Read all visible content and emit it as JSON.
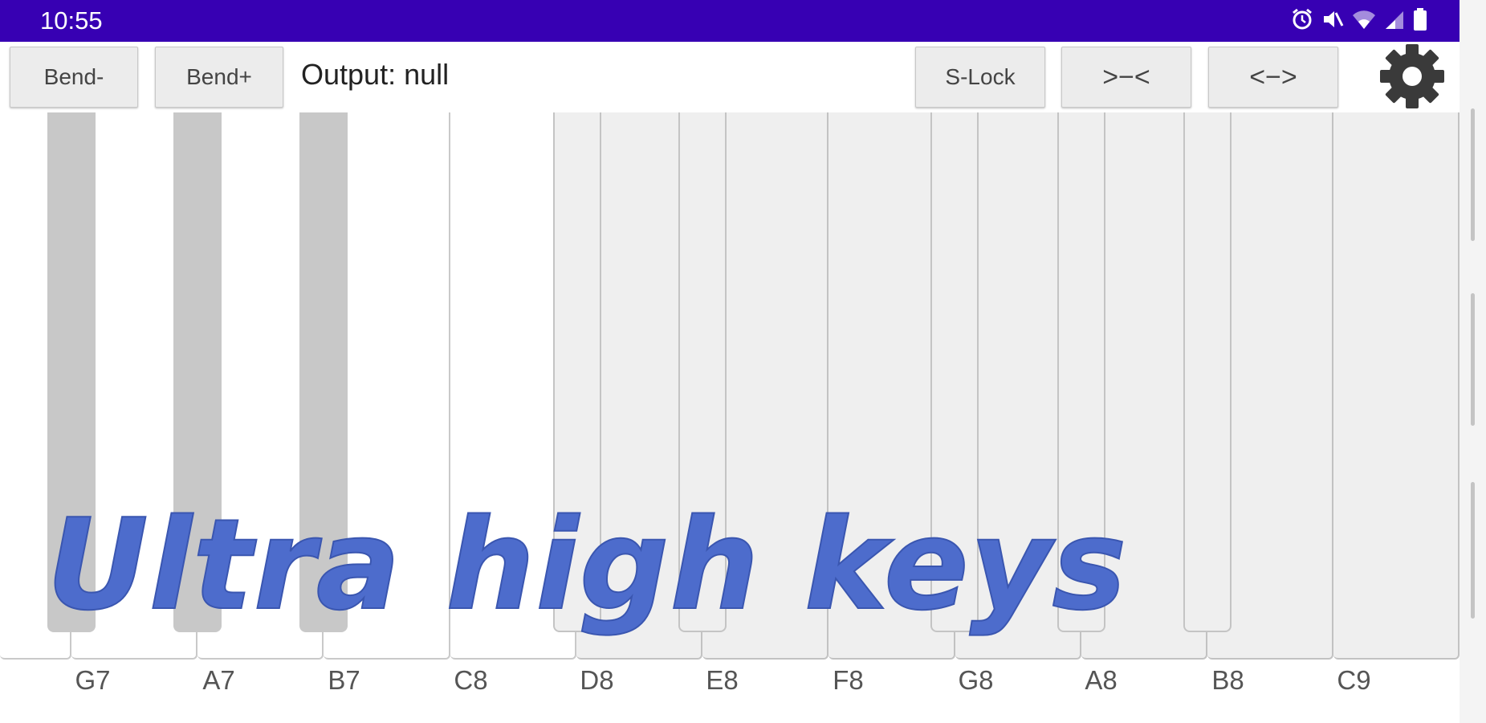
{
  "status_bar": {
    "time": "10:55",
    "icons": [
      "alarm-icon",
      "mute-icon",
      "wifi-icon",
      "signal-icon",
      "battery-icon"
    ]
  },
  "toolbar": {
    "bend_down_label": "Bend-",
    "bend_up_label": "Bend+",
    "output_text": "Output: null",
    "slock_label": "S-Lock",
    "shrink_label": ">−<",
    "expand_label": "<−>",
    "settings_icon": "gear-icon"
  },
  "keyboard": {
    "white_keys": [
      "G7",
      "A7",
      "B7",
      "C8",
      "D8",
      "E8",
      "F8",
      "G8",
      "A8",
      "B8",
      "C9"
    ],
    "ultra_high_from": "D8"
  },
  "overlay": {
    "title": "Ultra high keys",
    "color": "#4d6ccc"
  },
  "colors": {
    "status_bar": "#3700b3",
    "black_key": "#c8c8c8",
    "ultra_key": "#efefef"
  }
}
